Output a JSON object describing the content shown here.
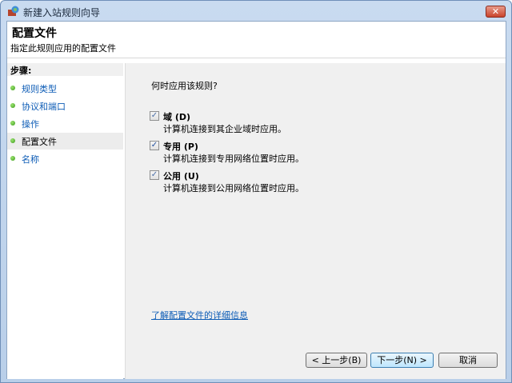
{
  "window": {
    "title": "新建入站规则向导",
    "close_label": "✕"
  },
  "header": {
    "title": "配置文件",
    "subtitle": "指定此规则应用的配置文件"
  },
  "steps": {
    "heading": "步骤:",
    "items": [
      {
        "label": "规则类型",
        "active": false
      },
      {
        "label": "协议和端口",
        "active": false
      },
      {
        "label": "操作",
        "active": false
      },
      {
        "label": "配置文件",
        "active": true
      },
      {
        "label": "名称",
        "active": false
      }
    ]
  },
  "main": {
    "question": "何时应用该规则?",
    "options": [
      {
        "label": "域 (D)",
        "description": "计算机连接到其企业域时应用。",
        "checked": true
      },
      {
        "label": "专用 (P)",
        "description": "计算机连接到专用网络位置时应用。",
        "checked": true
      },
      {
        "label": "公用 (U)",
        "description": "计算机连接到公用网络位置时应用。",
        "checked": true
      }
    ],
    "link": "了解配置文件的详细信息"
  },
  "buttons": {
    "back": "< 上一步(B)",
    "next": "下一步(N) >",
    "cancel": "取消"
  }
}
